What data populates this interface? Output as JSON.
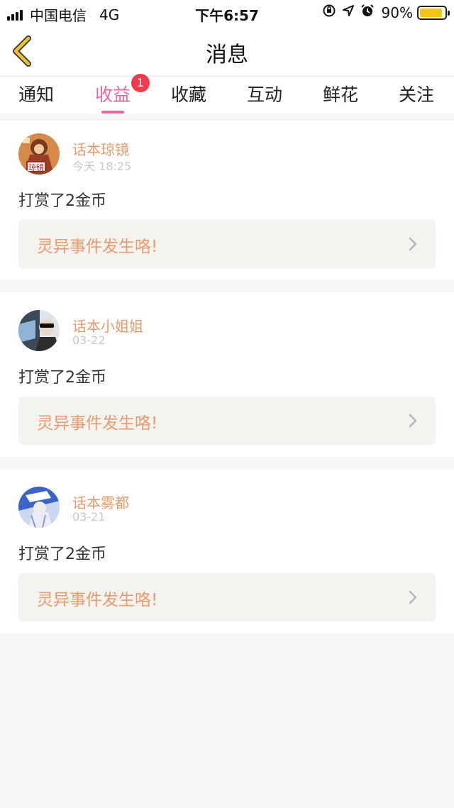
{
  "status_bar": {
    "carrier": "中国电信",
    "network": "4G",
    "time": "下午6:57",
    "battery_text": "90%",
    "battery_level": 0.9,
    "icons": [
      "orientation-lock-icon",
      "location-arrow-icon",
      "alarm-icon"
    ]
  },
  "navbar": {
    "title": "消息",
    "back_icon": "chevron-left-icon",
    "back_color": "#f2c230"
  },
  "tabs": [
    {
      "label": "通知"
    },
    {
      "label": "收益",
      "active": true,
      "badge": "1"
    },
    {
      "label": "收藏"
    },
    {
      "label": "互动"
    },
    {
      "label": "鲜花"
    },
    {
      "label": "关注"
    }
  ],
  "colors": {
    "accent": "#e9679f",
    "badge": "#f23a4e",
    "username": "#e59a6b",
    "link_text": "#ea9a6c",
    "link_bg": "#f4f3ef"
  },
  "messages": [
    {
      "username": "话本琼镜",
      "time": "今天 18:25",
      "text": "打赏了2金币",
      "link": "灵异事件发生咯!",
      "avatar_text": "琼镜"
    },
    {
      "username": "话本小姐姐",
      "time": "03-22",
      "text": "打赏了2金币",
      "link": "灵异事件发生咯!"
    },
    {
      "username": "话本雾都",
      "time": "03-21",
      "text": "打赏了2金币",
      "link": "灵异事件发生咯!"
    }
  ]
}
